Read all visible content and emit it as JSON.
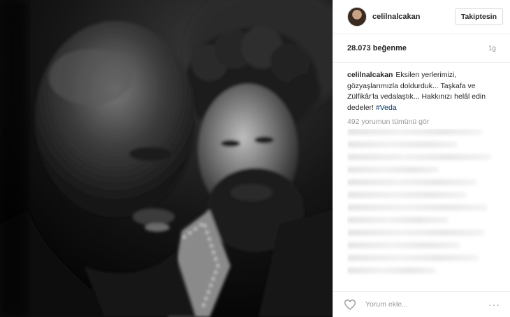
{
  "post": {
    "username": "celilnalcakan",
    "follow_label": "Takiptesin",
    "likes": "28.073 beğenme",
    "time_ago": "1g",
    "caption": {
      "user": "celilnalcakan",
      "text": "Eksilen yerlerimizi, gözyaşlarımızla doldurduk... Taşkafa ve Zülfikâr'la vedalaştık... Hakkınızı helâl edin dedeler!",
      "hashtag": "#Veda"
    },
    "view_comments": "492 yorumun tümünü gör",
    "comment_placeholder": "Yorum ekle...",
    "more_label": "···"
  },
  "icons": {
    "like": "heart-outline-icon",
    "more": "ellipsis-icon"
  },
  "colors": {
    "hashtag": "#003569",
    "muted": "#999999",
    "border": "#efefef"
  }
}
